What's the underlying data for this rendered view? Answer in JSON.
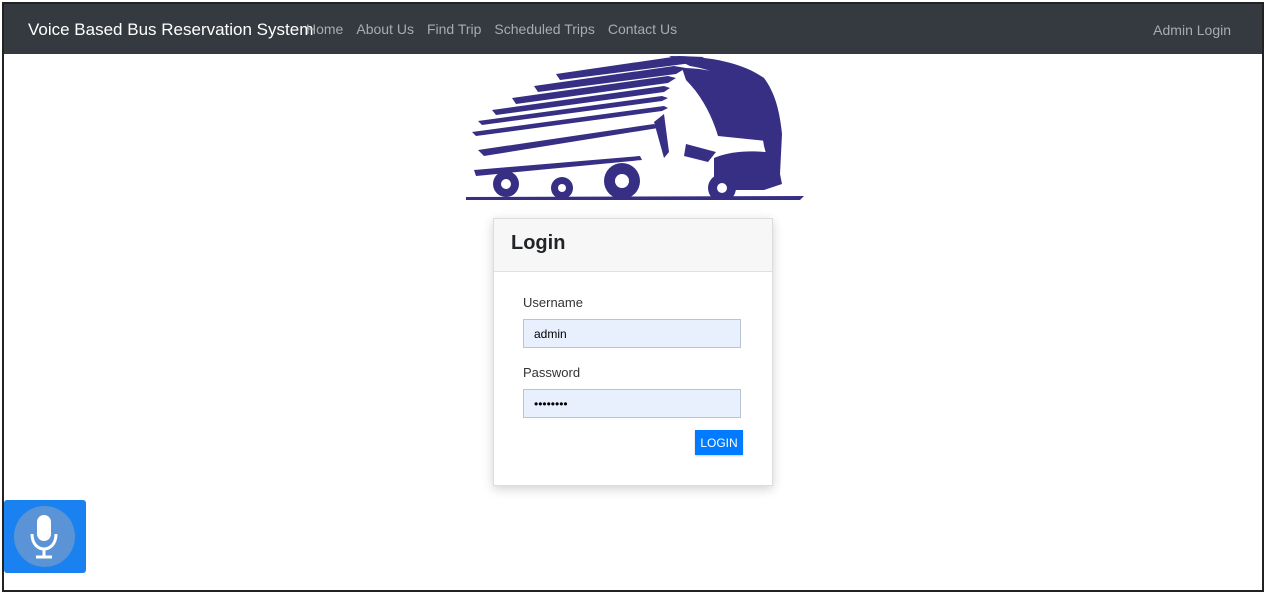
{
  "navbar": {
    "brand": "Voice Based Bus Reservation System",
    "links": [
      "Home",
      "About Us",
      "Find Trip",
      "Scheduled Trips",
      "Contact Us"
    ],
    "right_link": "Admin Login"
  },
  "login_card": {
    "title": "Login",
    "username_label": "Username",
    "username_value": "admin",
    "password_label": "Password",
    "password_value": "password",
    "button_label": "LOGIN"
  },
  "colors": {
    "navbar_bg": "#343a40",
    "logo": "#372f84",
    "primary": "#007bff",
    "input_bg": "#e8f0fe"
  },
  "icons": {
    "logo": "bus-icon",
    "voice": "microphone-icon"
  }
}
